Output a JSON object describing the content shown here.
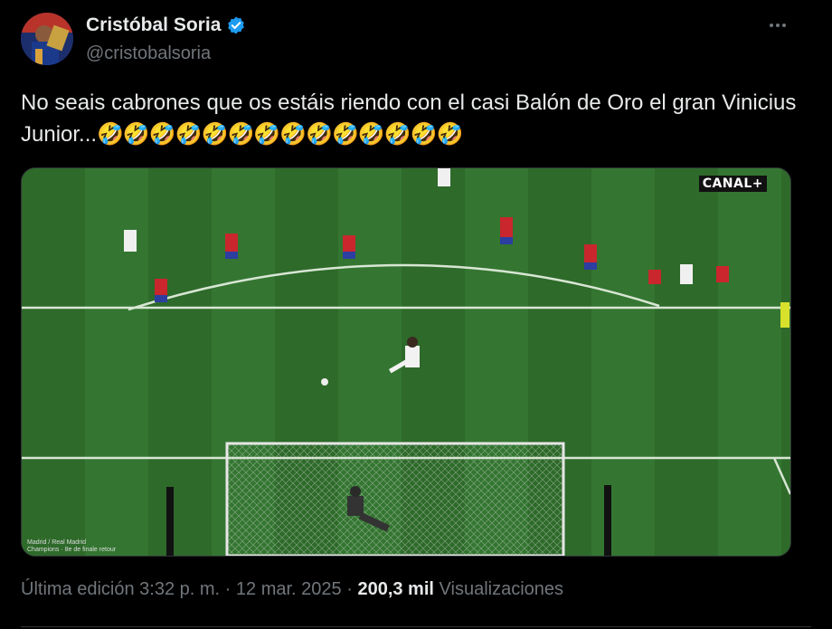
{
  "author": {
    "display_name": "Cristóbal Soria",
    "handle": "@cristobalsoria",
    "verified": true,
    "verified_color": "#1d9bf0"
  },
  "tweet": {
    "text": "No seais cabrones que os estáis riendo con el casi Balón de Oro el gran Vinicius Junior...",
    "emojis": "🤣🤣🤣🤣🤣🤣🤣🤣🤣🤣🤣🤣🤣🤣"
  },
  "media": {
    "broadcaster_logo": "CANAL+",
    "caption_line1": "Madrid / Real Madrid",
    "caption_line2": "Champions · 8e de finale retour"
  },
  "meta": {
    "edited_label": "Última edición",
    "time": "3:32 p. m.",
    "separator": "·",
    "date": "12 mar. 2025",
    "views_count": "200,3 mil",
    "views_label": "Visualizaciones"
  },
  "icons": {
    "more": "more-options-icon",
    "verified": "verified-badge-icon"
  },
  "colors": {
    "background": "#000000",
    "text_primary": "#e7e9ea",
    "text_secondary": "#71767b",
    "pitch": "#2f6b2b"
  }
}
